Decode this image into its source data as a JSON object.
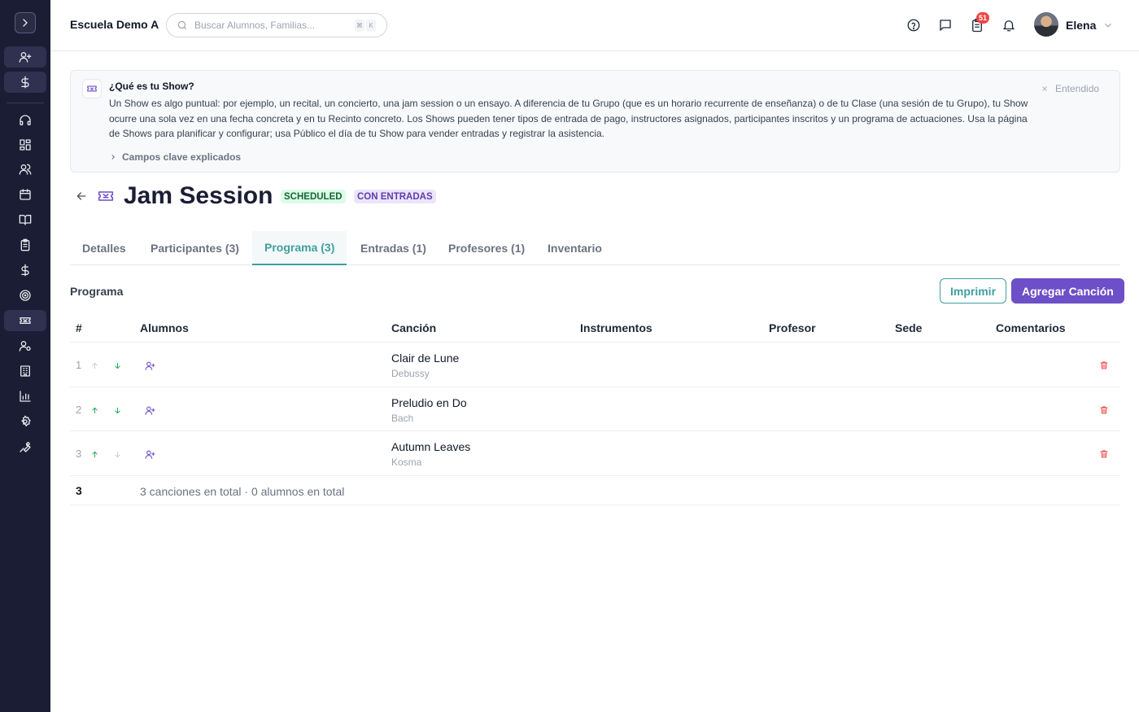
{
  "sidebar": {
    "toggle": "expand",
    "items": [
      {
        "icon": "user-plus-icon",
        "highlighted": true
      },
      {
        "icon": "dollar-icon",
        "highlighted": true
      },
      {
        "icon": "headset-icon"
      },
      {
        "icon": "dashboard-icon"
      },
      {
        "icon": "users-icon"
      },
      {
        "icon": "calendar-icon"
      },
      {
        "icon": "book-icon"
      },
      {
        "icon": "clipboard-icon"
      },
      {
        "icon": "dollar-icon"
      },
      {
        "icon": "target-icon"
      },
      {
        "icon": "ticket-icon",
        "active": true
      },
      {
        "icon": "user-cog-icon"
      },
      {
        "icon": "building-icon"
      },
      {
        "icon": "bar-chart-icon"
      },
      {
        "icon": "settings-icon"
      },
      {
        "icon": "wrench-icon"
      }
    ]
  },
  "header": {
    "school_name": "Escuela Demo A",
    "search_placeholder": "Buscar Alumnos, Familias...",
    "shortcut_keys": [
      "⌘",
      "K"
    ],
    "tasks_badge": "51",
    "user_name": "Elena"
  },
  "info_box": {
    "title": "¿Qué es tu Show?",
    "text": "Un Show es algo puntual: por ejemplo, un recital, un concierto, una jam session o un ensayo. A diferencia de tu Grupo (que es un horario recurrente de enseñanza) o de tu Clase (una sesión de tu Grupo), tu Show ocurre una sola vez en una fecha concreta y en tu Recinto concreto. Los Shows pueden tener tipos de entrada de pago, instructores asignados, participantes inscritos y un programa de actuaciones. Usa la página de Shows para planificar y configurar; usa Público el día de tu Show para vender entradas y registrar la asistencia.",
    "key_fields_label": "Campos clave explicados",
    "dismiss_label": "Entendido"
  },
  "show": {
    "title": "Jam Session",
    "status_badge": "SCHEDULED",
    "ticket_badge": "CON ENTRADAS"
  },
  "tabs": [
    {
      "label": "Detalles"
    },
    {
      "label": "Participantes (3)"
    },
    {
      "label": "Programa (3)",
      "active": true
    },
    {
      "label": "Entradas (1)"
    },
    {
      "label": "Profesores (1)"
    },
    {
      "label": "Inventario"
    }
  ],
  "programa": {
    "section_title": "Programa",
    "print_label": "Imprimir",
    "add_song_label": "Agregar Canción",
    "columns": [
      "#",
      "Alumnos",
      "Canción",
      "Instrumentos",
      "Profesor",
      "Sede",
      "Comentarios"
    ],
    "rows": [
      {
        "num": "1",
        "song": "Clair de Lune",
        "composer": "Debussy",
        "can_move_up": false,
        "can_move_down": true
      },
      {
        "num": "2",
        "song": "Preludio en Do",
        "composer": "Bach",
        "can_move_up": true,
        "can_move_down": true
      },
      {
        "num": "3",
        "song": "Autumn Leaves",
        "composer": "Kosma",
        "can_move_up": true,
        "can_move_down": false
      }
    ],
    "total_count": "3",
    "total_text": "3 canciones en total · 0 alumnos en total"
  }
}
